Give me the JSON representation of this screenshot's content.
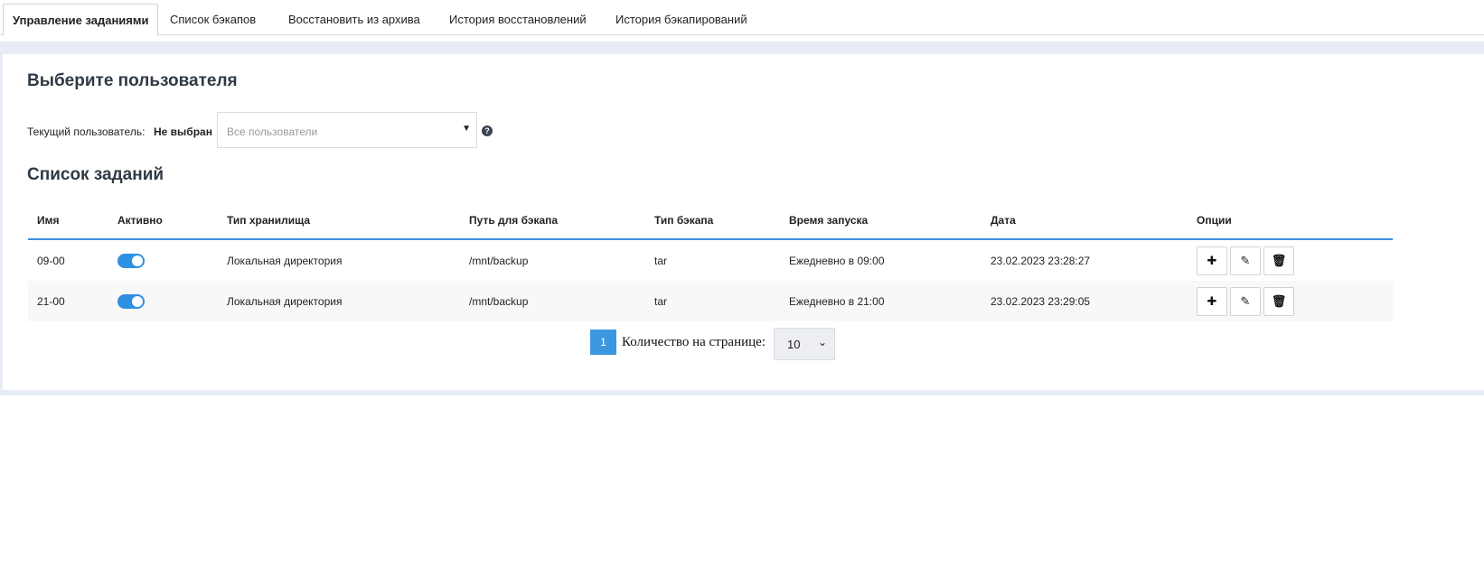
{
  "tabs": [
    {
      "label": "Управление заданиями",
      "active": true
    },
    {
      "label": "Список бэкапов"
    },
    {
      "label": "Восстановить из архива"
    },
    {
      "label": "История восстановлений"
    },
    {
      "label": "История бэкапирований"
    }
  ],
  "user_section": {
    "title": "Выберите пользователя",
    "current_label": "Текущий пользователь:",
    "current_value": "Не выбран",
    "select_placeholder": "Все пользователи",
    "help_icon": "question-circle-icon"
  },
  "jobs": {
    "title": "Список заданий",
    "columns": [
      "Имя",
      "Активно",
      "Тип хранилища",
      "Путь для бэкапа",
      "Тип бэкапа",
      "Время запуска",
      "Дата",
      "Опции"
    ],
    "rows": [
      {
        "name": "09-00",
        "active": true,
        "storage": "Локальная директория",
        "path": "/mnt/backup",
        "type": "tar",
        "schedule": "Ежедневно в 09:00",
        "date": "23.02.2023 23:28:27"
      },
      {
        "name": "21-00",
        "active": true,
        "storage": "Локальная директория",
        "path": "/mnt/backup",
        "type": "tar",
        "schedule": "Ежедневно в 21:00",
        "date": "23.02.2023 23:29:05"
      }
    ]
  },
  "pagination": {
    "page": "1",
    "per_page_label": "Количество на странице:",
    "per_page_value": "10"
  },
  "colors": {
    "accent": "#3b97e0",
    "toggle_on": "#2f8fe3",
    "background_stripe": "#e8edf5"
  }
}
